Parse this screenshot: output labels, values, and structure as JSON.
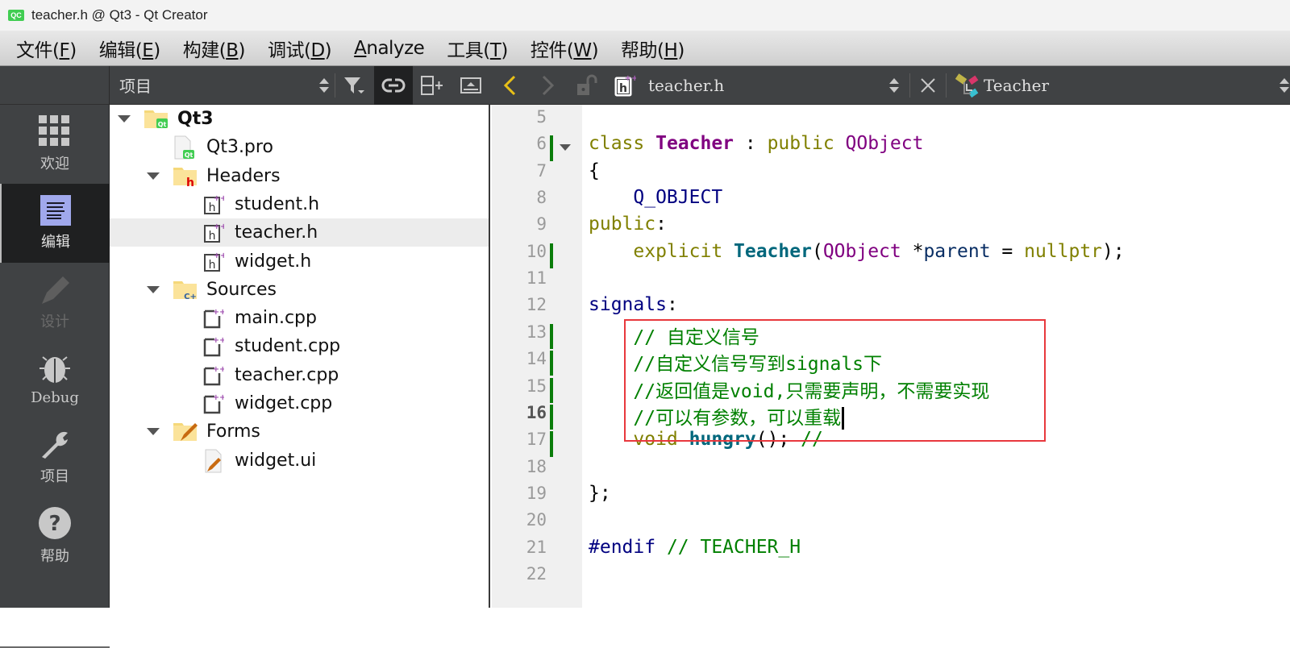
{
  "window": {
    "app_icon": "qt-creator-icon",
    "title": "teacher.h @ Qt3 - Qt Creator"
  },
  "menubar": {
    "items": [
      {
        "label": "文件",
        "mnemonic": "F"
      },
      {
        "label": "编辑",
        "mnemonic": "E"
      },
      {
        "label": "构建",
        "mnemonic": "B"
      },
      {
        "label": "调试",
        "mnemonic": "D"
      },
      {
        "label": "Analyze",
        "mnemonic": "A"
      },
      {
        "label": "工具",
        "mnemonic": "T"
      },
      {
        "label": "控件",
        "mnemonic": "W"
      },
      {
        "label": "帮助",
        "mnemonic": "H"
      }
    ]
  },
  "modes": [
    {
      "label": "欢迎",
      "icon": "welcome-grid-icon",
      "state": "normal"
    },
    {
      "label": "编辑",
      "icon": "edit-document-icon",
      "state": "active"
    },
    {
      "label": "设计",
      "icon": "design-pencil-icon",
      "state": "disabled"
    },
    {
      "label": "Debug",
      "icon": "debug-bug-icon",
      "state": "normal"
    },
    {
      "label": "项目",
      "icon": "projects-wrench-icon",
      "state": "normal"
    },
    {
      "label": "帮助",
      "icon": "help-question-icon",
      "state": "normal"
    }
  ],
  "project_pane": {
    "view_selector": "项目",
    "toolbar_icons": [
      "filter-icon",
      "link-icon",
      "split-add-icon",
      "close-pane-icon"
    ]
  },
  "tree": [
    {
      "label": "Qt3",
      "level": 0,
      "icon": "qt-project-folder-icon",
      "expanded": true,
      "bold": true
    },
    {
      "label": "Qt3.pro",
      "level": 1,
      "icon": "qt-pro-file-icon"
    },
    {
      "label": "Headers",
      "level": 1,
      "icon": "headers-folder-icon",
      "expanded": true
    },
    {
      "label": "student.h",
      "level": 2,
      "icon": "cpp-header-icon"
    },
    {
      "label": "teacher.h",
      "level": 2,
      "icon": "cpp-header-icon",
      "selected": true
    },
    {
      "label": "widget.h",
      "level": 2,
      "icon": "cpp-header-icon"
    },
    {
      "label": "Sources",
      "level": 1,
      "icon": "sources-folder-icon",
      "expanded": true
    },
    {
      "label": "main.cpp",
      "level": 2,
      "icon": "cpp-source-icon"
    },
    {
      "label": "student.cpp",
      "level": 2,
      "icon": "cpp-source-icon"
    },
    {
      "label": "teacher.cpp",
      "level": 2,
      "icon": "cpp-source-icon"
    },
    {
      "label": "widget.cpp",
      "level": 2,
      "icon": "cpp-source-icon"
    },
    {
      "label": "Forms",
      "level": 1,
      "icon": "forms-folder-icon",
      "expanded": true
    },
    {
      "label": "widget.ui",
      "level": 2,
      "icon": "ui-file-icon"
    }
  ],
  "editor_toolbar": {
    "current_file": "teacher.h",
    "current_symbol": "Teacher"
  },
  "editor": {
    "current_line": 16,
    "lines": [
      {
        "n": "5",
        "tokens": []
      },
      {
        "n": "6",
        "tokens": [
          [
            "kw",
            "class "
          ],
          [
            "type",
            "Teacher"
          ],
          [
            "plain",
            " : "
          ],
          [
            "kw",
            "public "
          ],
          [
            "cls",
            "QObject"
          ]
        ],
        "changed": true,
        "fold": true
      },
      {
        "n": "7",
        "tokens": [
          [
            "plain",
            "{"
          ]
        ]
      },
      {
        "n": "8",
        "tokens": [
          [
            "plain",
            "    "
          ],
          [
            "macro",
            "Q_OBJECT"
          ]
        ]
      },
      {
        "n": "9",
        "tokens": [
          [
            "kw",
            "public"
          ],
          [
            "plain",
            ":"
          ]
        ]
      },
      {
        "n": "10",
        "tokens": [
          [
            "plain",
            "    "
          ],
          [
            "kw",
            "explicit "
          ],
          [
            "fn",
            "Teacher"
          ],
          [
            "plain",
            "("
          ],
          [
            "cls",
            "QObject"
          ],
          [
            "plain",
            " *"
          ],
          [
            "param",
            "parent"
          ],
          [
            "plain",
            " = "
          ],
          [
            "kw",
            "nullptr"
          ],
          [
            "plain",
            ");"
          ]
        ],
        "changed": true
      },
      {
        "n": "11",
        "tokens": []
      },
      {
        "n": "12",
        "tokens": [
          [
            "label",
            "signals"
          ],
          [
            "plain",
            ":"
          ]
        ]
      },
      {
        "n": "13",
        "tokens": [
          [
            "plain",
            "    "
          ],
          [
            "cmt",
            "// 自定义信号"
          ]
        ],
        "changed": true
      },
      {
        "n": "14",
        "tokens": [
          [
            "plain",
            "    "
          ],
          [
            "cmt",
            "//自定义信号写到signals下"
          ]
        ],
        "changed": true
      },
      {
        "n": "15",
        "tokens": [
          [
            "plain",
            "    "
          ],
          [
            "cmt",
            "//返回值是void,只需要声明，不需要实现"
          ]
        ],
        "changed": true
      },
      {
        "n": "16",
        "tokens": [
          [
            "plain",
            "    "
          ],
          [
            "cmt",
            "//可以有参数，可以重载"
          ]
        ],
        "changed": true,
        "cursor": true
      },
      {
        "n": "17",
        "tokens": [
          [
            "plain",
            "    "
          ],
          [
            "kw",
            "void "
          ],
          [
            "fn",
            "hungry"
          ],
          [
            "plain",
            "(); "
          ],
          [
            "cmt",
            "//"
          ]
        ],
        "changed": true
      },
      {
        "n": "18",
        "tokens": []
      },
      {
        "n": "19",
        "tokens": [
          [
            "plain",
            "};"
          ]
        ]
      },
      {
        "n": "20",
        "tokens": []
      },
      {
        "n": "21",
        "tokens": [
          [
            "pp",
            "#endif "
          ],
          [
            "cmt",
            "// TEACHER_H"
          ]
        ]
      },
      {
        "n": "22",
        "tokens": []
      }
    ]
  },
  "annotation": {
    "highlight_color": "#e8383d",
    "covers_lines": [
      13,
      16
    ]
  }
}
